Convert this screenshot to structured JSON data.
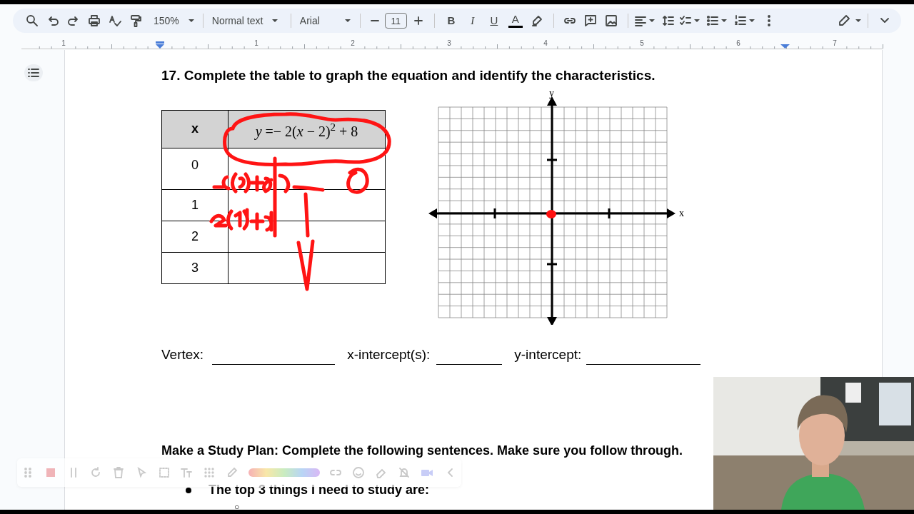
{
  "toolbar": {
    "zoom": "150%",
    "style": "Normal text",
    "font": "Arial",
    "font_size": "11",
    "format_buttons": [
      {
        "label": "B",
        "kind": "bold"
      },
      {
        "label": "I",
        "kind": "italic"
      },
      {
        "label": "U",
        "kind": "underline"
      },
      {
        "label": "A",
        "kind": "text-color"
      }
    ]
  },
  "ruler": {
    "labels": [
      "1",
      "1",
      "2",
      "3",
      "4",
      "5",
      "6",
      "7"
    ]
  },
  "document": {
    "question": "17.  Complete the table to graph the equation and identify the characteristics.",
    "table": {
      "columns": [
        "x",
        "*y* =− 2(*x* − 2)$^{2}$ + 8"
      ],
      "x_values": [
        "0",
        "1",
        "2",
        "3"
      ]
    },
    "graph": {
      "x_label": "x",
      "y_label": "y"
    },
    "blanks": [
      {
        "label": "Vertex:"
      },
      {
        "label": "x-intercept(s):"
      },
      {
        "label": "y-intercept:"
      }
    ],
    "study_plan": {
      "heading": "Make a Study Plan: Complete the following sentences. Make sure you follow through.",
      "bullets": [
        "The top 3 things I need to study are:"
      ],
      "sub_bullet_marker": "○"
    }
  }
}
